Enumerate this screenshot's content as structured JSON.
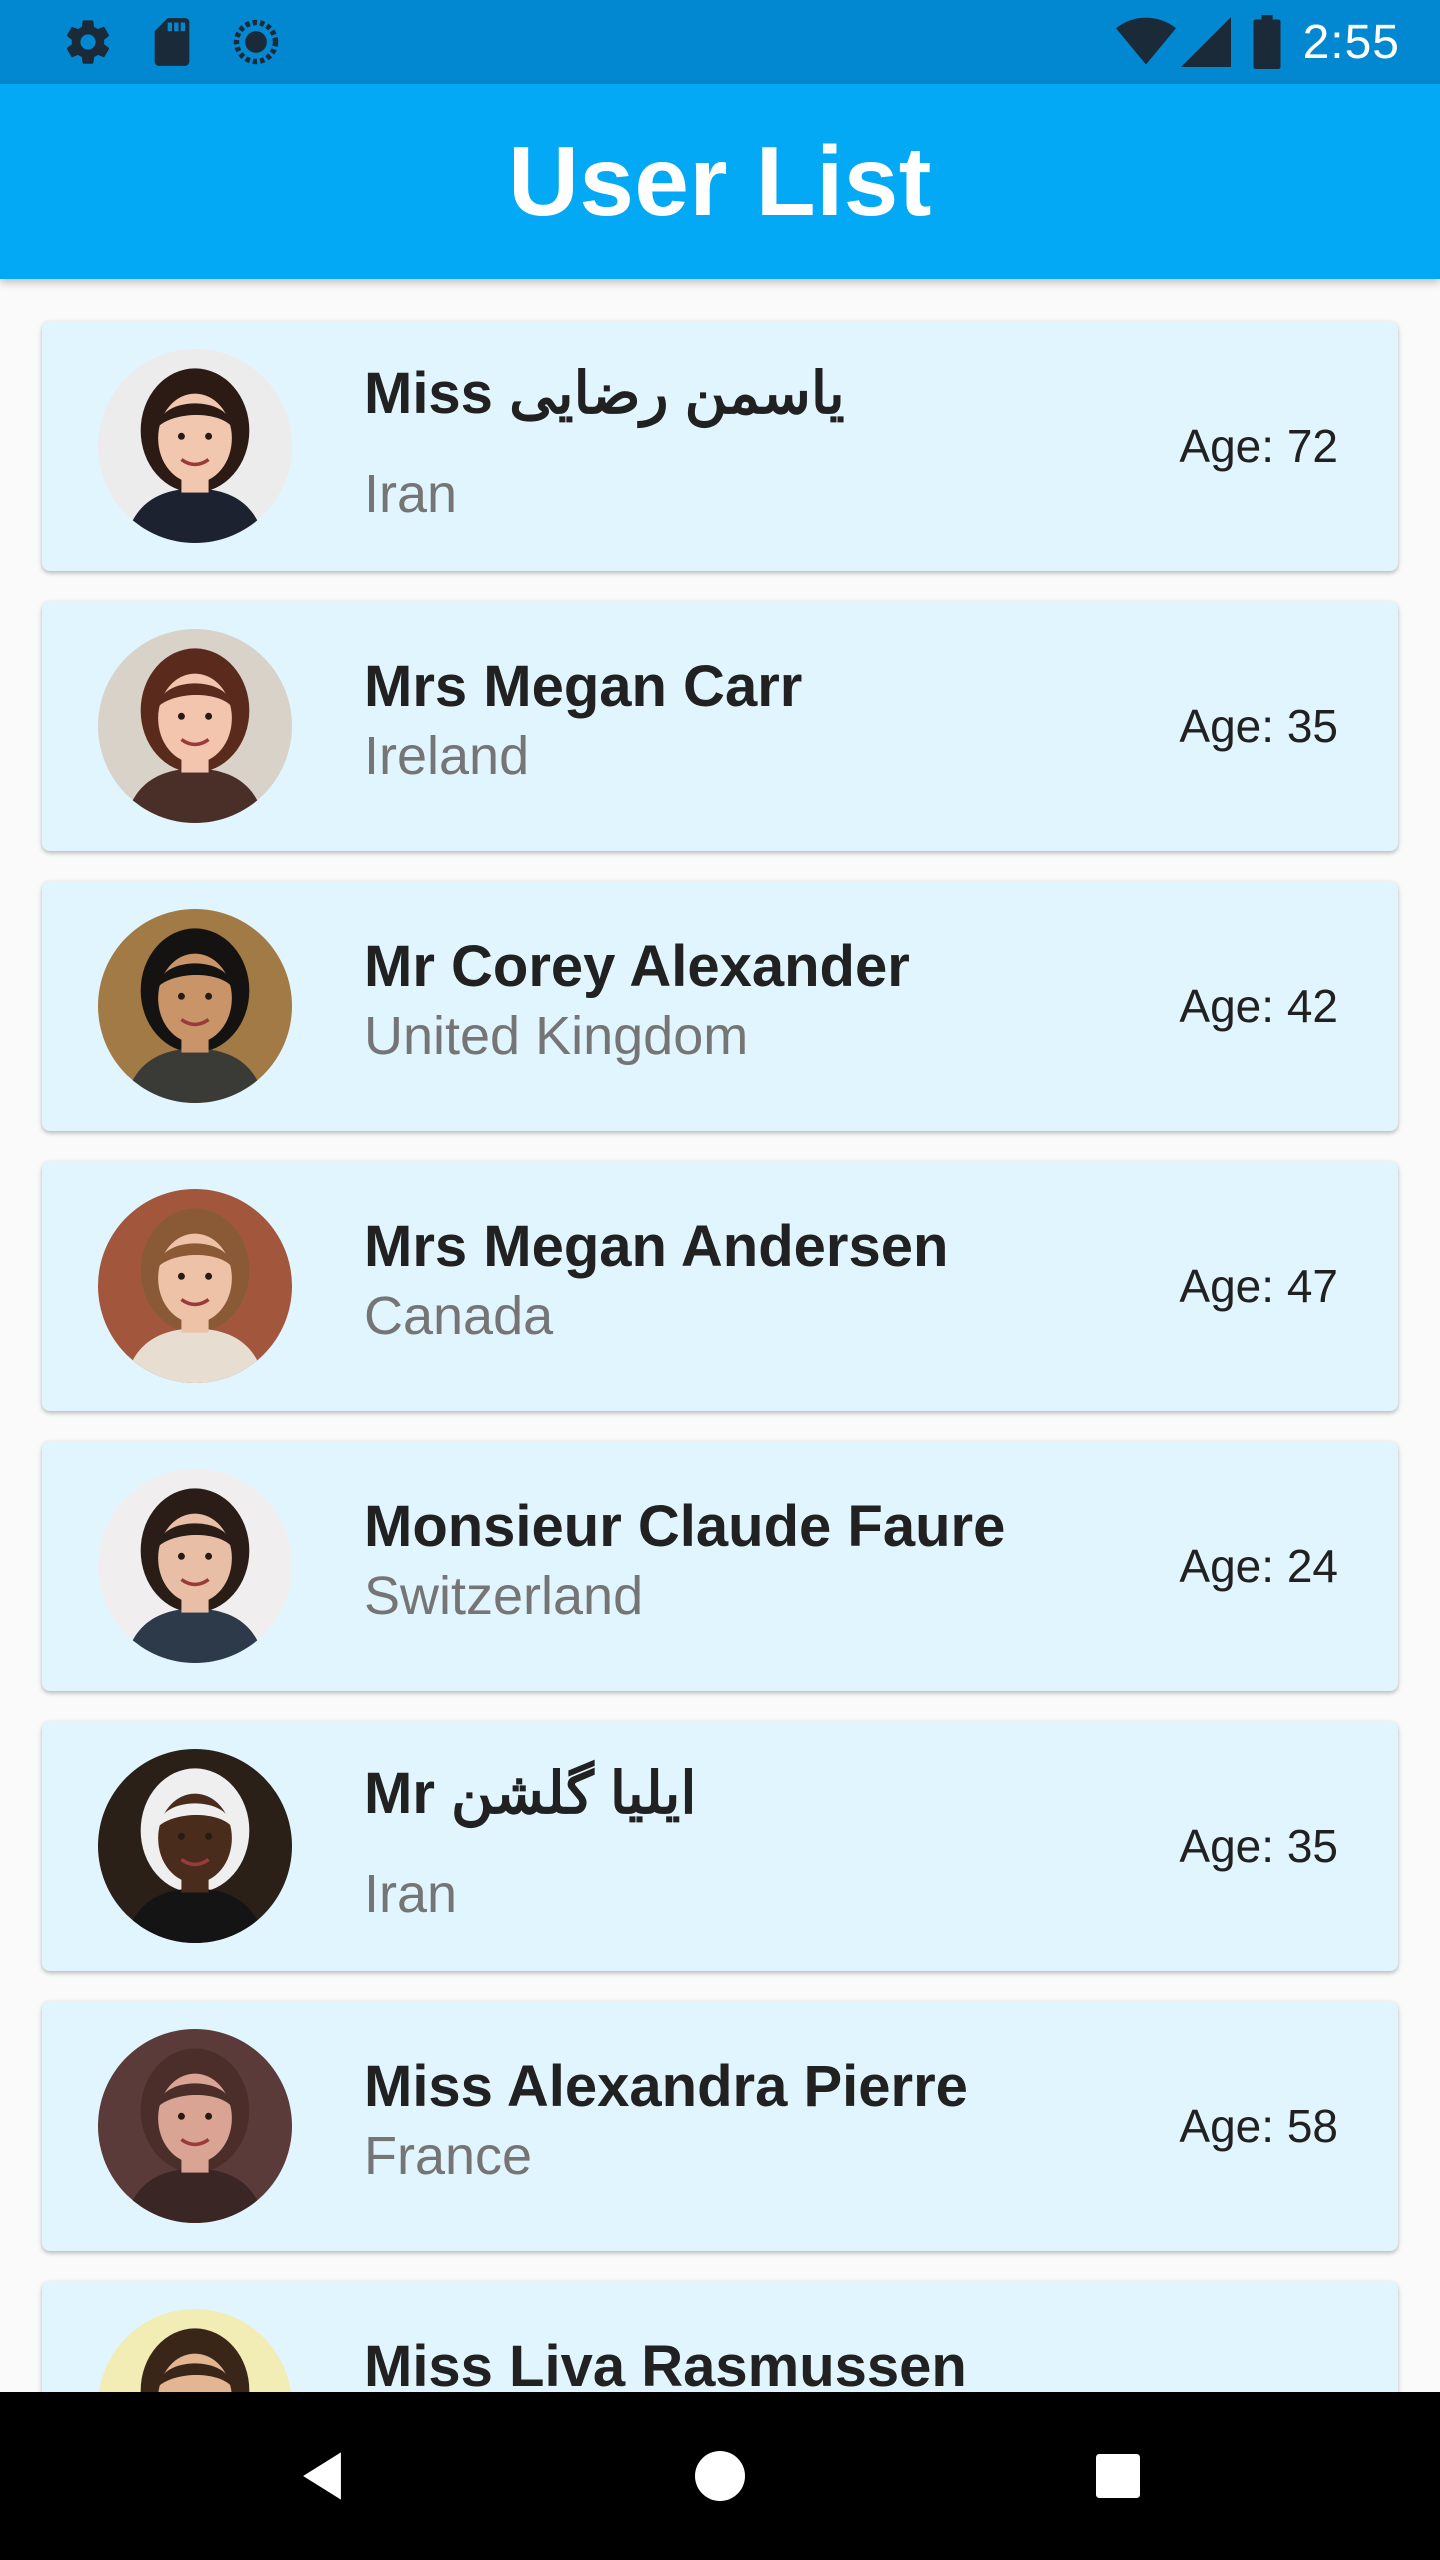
{
  "status_bar": {
    "time": "2:55",
    "left_icons": [
      "settings-icon",
      "sd-card-icon",
      "sync-icon"
    ],
    "right_icons": [
      "wifi-icon",
      "cellular-signal-icon",
      "battery-icon"
    ]
  },
  "app_bar": {
    "title": "User List"
  },
  "users": [
    {
      "name": "Miss ياسمن رضایی",
      "name_prefix": "Miss",
      "name_rtl": "ياسمن رضایی",
      "country": "Iran",
      "age": "Age: 72",
      "avatar_skin": "#f1c7b0",
      "avatar_hair": "#2b1b14",
      "avatar_bg": "#ececec",
      "avatar_shirt": "#1c2230"
    },
    {
      "name": "Mrs Megan Carr",
      "country": "Ireland",
      "age": "Age: 35",
      "avatar_skin": "#f3c4ae",
      "avatar_hair": "#5a2a1c",
      "avatar_bg": "#d9d2c9",
      "avatar_shirt": "#4a2f28"
    },
    {
      "name": "Mr Corey Alexander",
      "country": "United Kingdom",
      "age": "Age: 42",
      "avatar_skin": "#c99468",
      "avatar_hair": "#151311",
      "avatar_bg": "#a27a45",
      "avatar_shirt": "#3a3a36"
    },
    {
      "name": "Mrs Megan Andersen",
      "country": "Canada",
      "age": "Age: 47",
      "avatar_skin": "#edc2a6",
      "avatar_hair": "#8a5a36",
      "avatar_bg": "#a2573d",
      "avatar_shirt": "#e8ddd1"
    },
    {
      "name": "Monsieur Claude Faure",
      "country": "Switzerland",
      "age": "Age: 24",
      "avatar_skin": "#e8bfa6",
      "avatar_hair": "#2a1d17",
      "avatar_bg": "#f0eeee",
      "avatar_shirt": "#2c3a4a"
    },
    {
      "name": "Mr ایلیا گلشن",
      "name_prefix": "Mr",
      "name_rtl": "ایلیا گلشن",
      "country": "Iran",
      "age": "Age: 35",
      "avatar_skin": "#4a2c1d",
      "avatar_hair": "#efefef",
      "avatar_bg": "#2b2018",
      "avatar_shirt": "#141414"
    },
    {
      "name": "Miss Alexandra Pierre",
      "country": "France",
      "age": "Age: 58",
      "avatar_skin": "#d9a493",
      "avatar_hair": "#4b2e2a",
      "avatar_bg": "#5a3b3a",
      "avatar_shirt": "#3b2626"
    },
    {
      "name": "Miss Liva Rasmussen",
      "country": "",
      "age": "",
      "avatar_skin": "#e4b591",
      "avatar_hair": "#3a2619",
      "avatar_bg": "#f2ecb5",
      "avatar_shirt": "#3a2619"
    }
  ],
  "nav_bar": {
    "buttons": [
      "back-icon",
      "home-icon",
      "recents-icon"
    ]
  }
}
